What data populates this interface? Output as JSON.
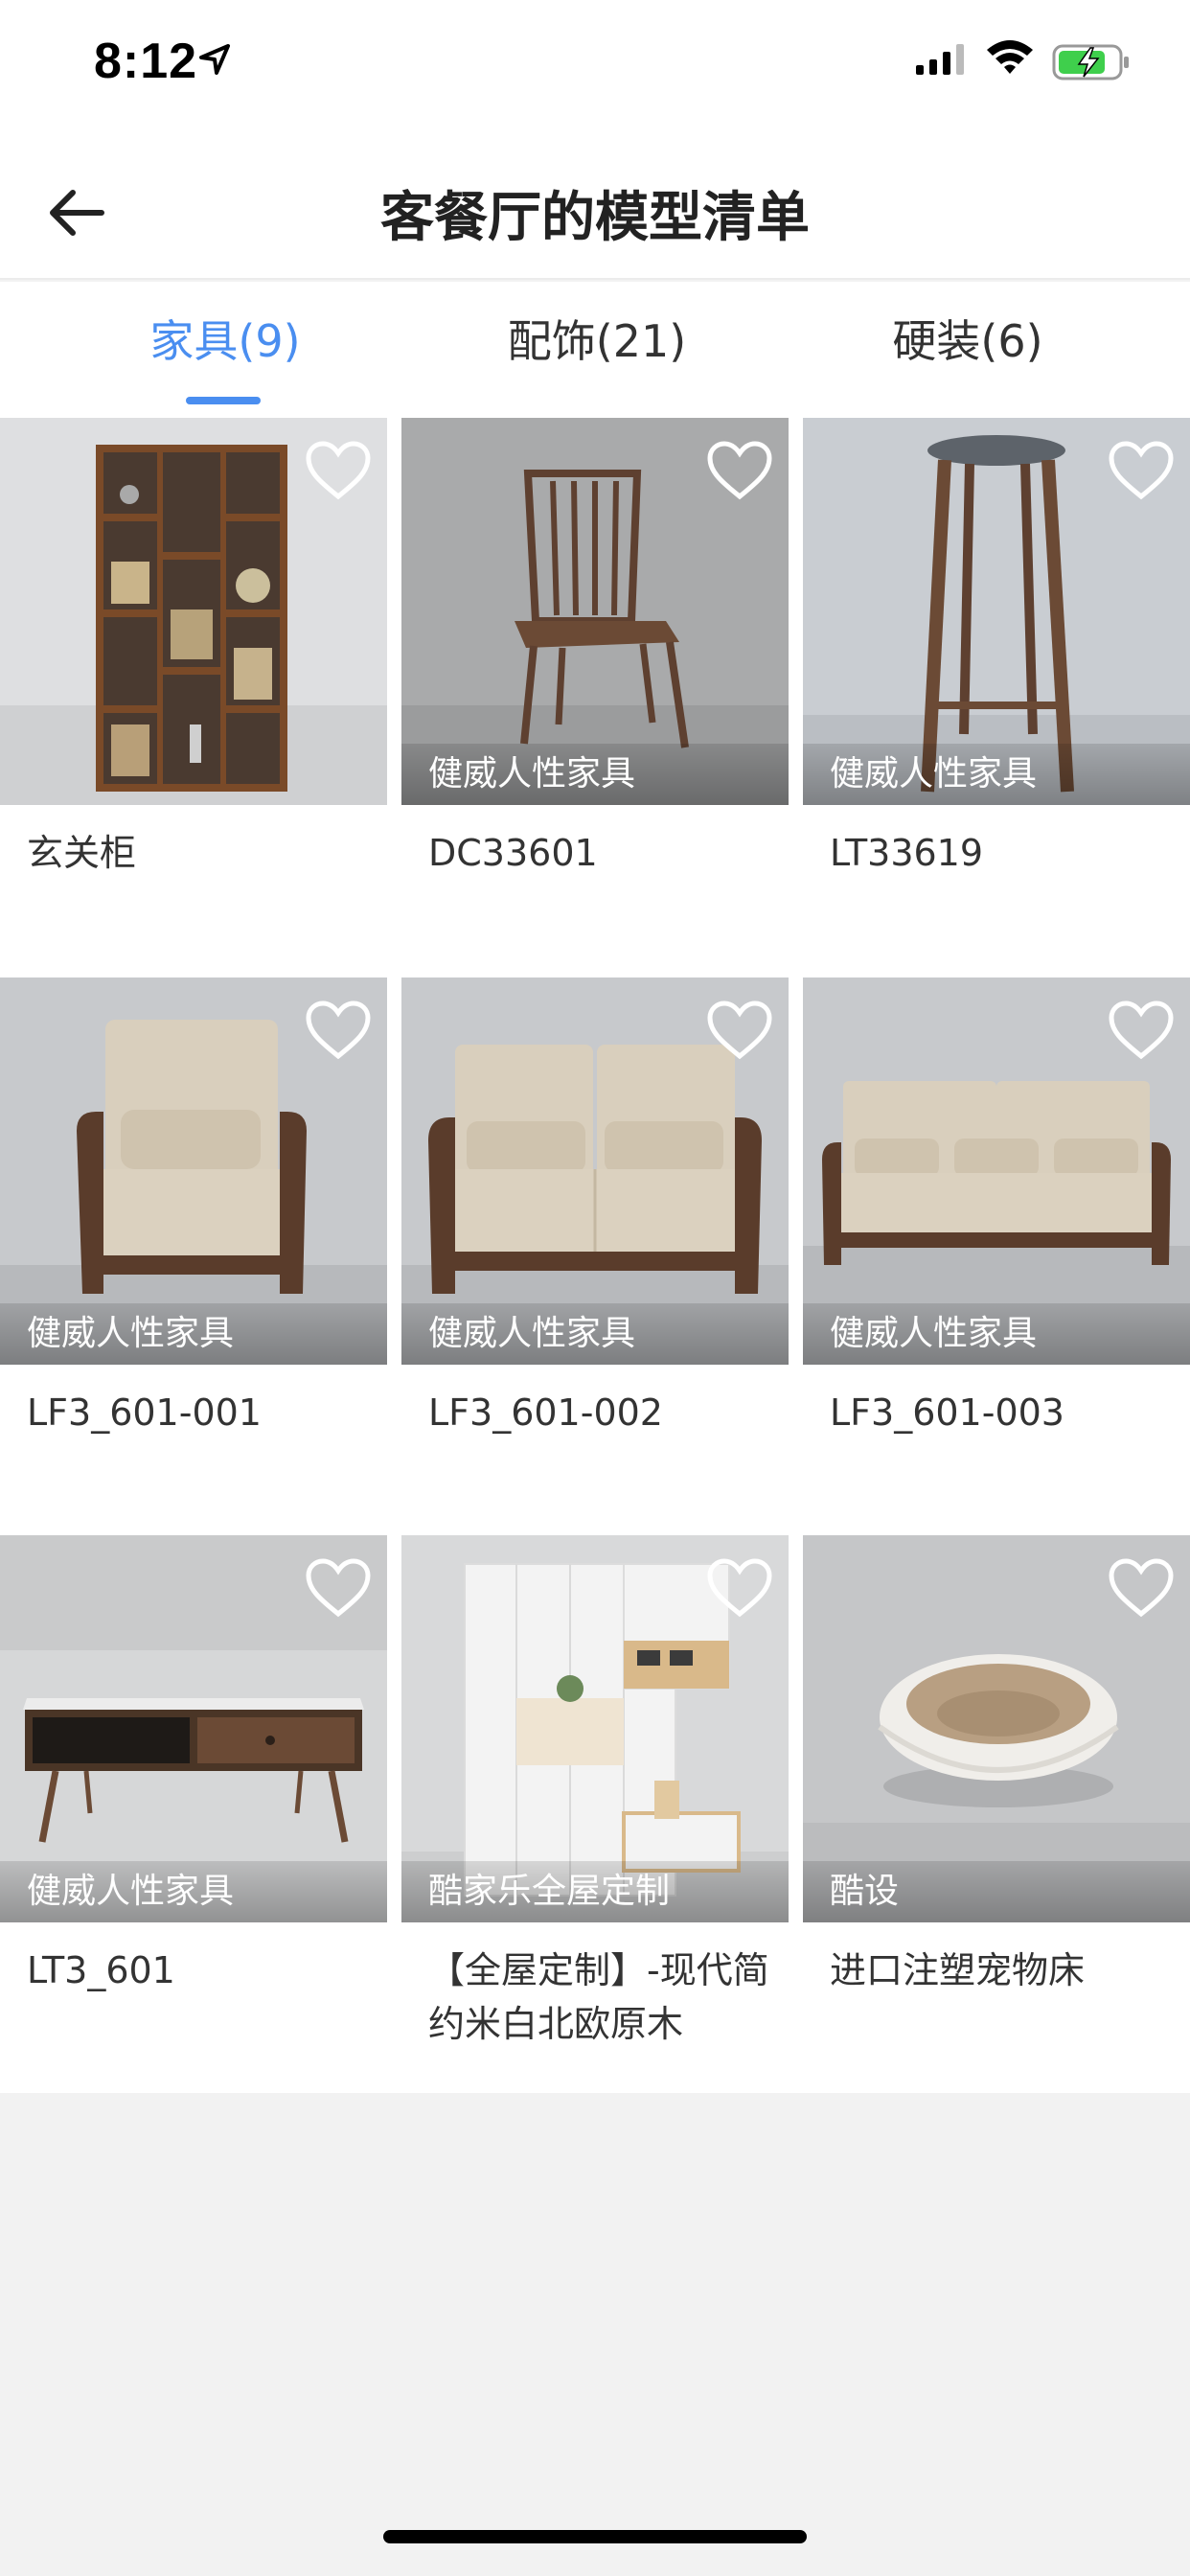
{
  "status": {
    "time": "8:12"
  },
  "nav": {
    "title": "客餐厅的模型清单",
    "back_icon": "arrow-left-icon"
  },
  "tabs": [
    {
      "label": "家具(9)",
      "active": true
    },
    {
      "label": "配饰(21)",
      "active": false
    },
    {
      "label": "硬装(6)",
      "active": false
    }
  ],
  "accent_color": "#4a8ef0",
  "items": [
    {
      "title": "玄关柜",
      "brand": "",
      "image": "bookshelf"
    },
    {
      "title": "DC33601",
      "brand": "健威人性家具",
      "image": "wooden-chair"
    },
    {
      "title": "LT33619",
      "brand": "健威人性家具",
      "image": "bar-stool"
    },
    {
      "title": "LF3_601-001",
      "brand": "健威人性家具",
      "image": "armchair"
    },
    {
      "title": "LF3_601-002",
      "brand": "健威人性家具",
      "image": "loveseat"
    },
    {
      "title": "LF3_601-003",
      "brand": "健威人性家具",
      "image": "three-seat-sofa"
    },
    {
      "title": "LT3_601",
      "brand": "健威人性家具",
      "image": "coffee-table"
    },
    {
      "title": "【全屋定制】-现代简约米白北欧原木",
      "brand": "酷家乐全屋定制",
      "image": "wardrobe-cabinet"
    },
    {
      "title": "进口注塑宠物床",
      "brand": "酷设",
      "image": "pet-bed"
    }
  ]
}
